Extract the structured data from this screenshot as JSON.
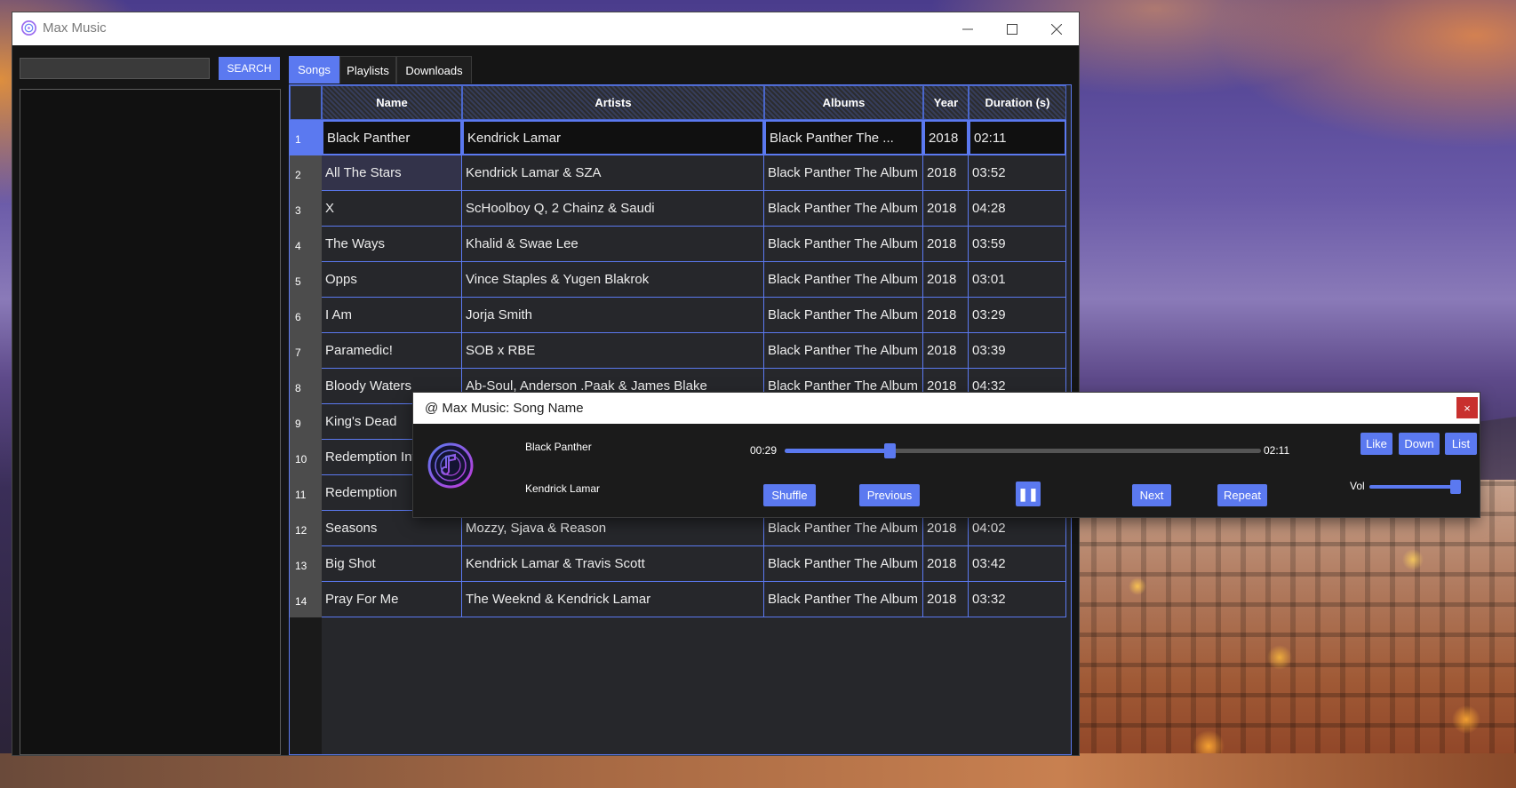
{
  "app": {
    "title": "Max Music"
  },
  "search": {
    "placeholder": "",
    "button_label": "SEARCH"
  },
  "tabs": [
    {
      "label": "Songs",
      "active": true
    },
    {
      "label": "Playlists",
      "active": false
    },
    {
      "label": "Downloads",
      "active": false
    }
  ],
  "table": {
    "columns": [
      "Name",
      "Artists",
      "Albums",
      "Year",
      "Duration (s)"
    ],
    "rows": [
      {
        "num": "1",
        "name": "Black Panther",
        "artists": "Kendrick Lamar",
        "album": "Black Panther The ...",
        "year": "2018",
        "duration": "02:11"
      },
      {
        "num": "2",
        "name": "All The Stars",
        "artists": "Kendrick Lamar & SZA",
        "album": "Black Panther The Album",
        "year": "2018",
        "duration": "03:52"
      },
      {
        "num": "3",
        "name": "X",
        "artists": "ScHoolboy Q, 2 Chainz & Saudi",
        "album": "Black Panther The Album",
        "year": "2018",
        "duration": "04:28"
      },
      {
        "num": "4",
        "name": "The Ways",
        "artists": "Khalid & Swae Lee",
        "album": "Black Panther The Album",
        "year": "2018",
        "duration": "03:59"
      },
      {
        "num": "5",
        "name": "Opps",
        "artists": "Vince Staples & Yugen Blakrok",
        "album": "Black Panther The Album",
        "year": "2018",
        "duration": "03:01"
      },
      {
        "num": "6",
        "name": "I Am",
        "artists": "Jorja Smith",
        "album": "Black Panther The Album",
        "year": "2018",
        "duration": "03:29"
      },
      {
        "num": "7",
        "name": "Paramedic!",
        "artists": "SOB x RBE",
        "album": "Black Panther The Album",
        "year": "2018",
        "duration": "03:39"
      },
      {
        "num": "8",
        "name": "Bloody Waters",
        "artists": "Ab-Soul, Anderson .Paak & James Blake",
        "album": "Black Panther The Album",
        "year": "2018",
        "duration": "04:32"
      },
      {
        "num": "9",
        "name": "King's Dead",
        "artists": "",
        "album": "",
        "year": "",
        "duration": ""
      },
      {
        "num": "10",
        "name": "Redemption Interlude",
        "artists": "",
        "album": "",
        "year": "",
        "duration": ""
      },
      {
        "num": "11",
        "name": "Redemption",
        "artists": "",
        "album": "",
        "year": "",
        "duration": ""
      },
      {
        "num": "12",
        "name": "Seasons",
        "artists": "Mozzy, Sjava & Reason",
        "album": "Black Panther The Album",
        "year": "2018",
        "duration": "04:02"
      },
      {
        "num": "13",
        "name": "Big Shot",
        "artists": "Kendrick Lamar & Travis Scott",
        "album": "Black Panther The Album",
        "year": "2018",
        "duration": "03:42"
      },
      {
        "num": "14",
        "name": "Pray For Me",
        "artists": "The Weeknd & Kendrick Lamar",
        "album": "Black Panther The Album",
        "year": "2018",
        "duration": "03:32"
      }
    ]
  },
  "player": {
    "window_title": "@ Max Music: Song Name",
    "close_label": "×",
    "song_title": "Black Panther",
    "artist": "Kendrick Lamar",
    "current_time": "00:29",
    "total_time": "02:11",
    "progress_fraction": 0.22,
    "volume_fraction": 0.95,
    "buttons": {
      "shuffle": "Shuffle",
      "previous": "Previous",
      "pause": "❚❚",
      "next": "Next",
      "repeat": "Repeat",
      "like": "Like",
      "down": "Down",
      "list": "List"
    },
    "volume_label": "Vol"
  },
  "colors": {
    "accent": "#5b79f0",
    "close_red": "#c8302e"
  }
}
